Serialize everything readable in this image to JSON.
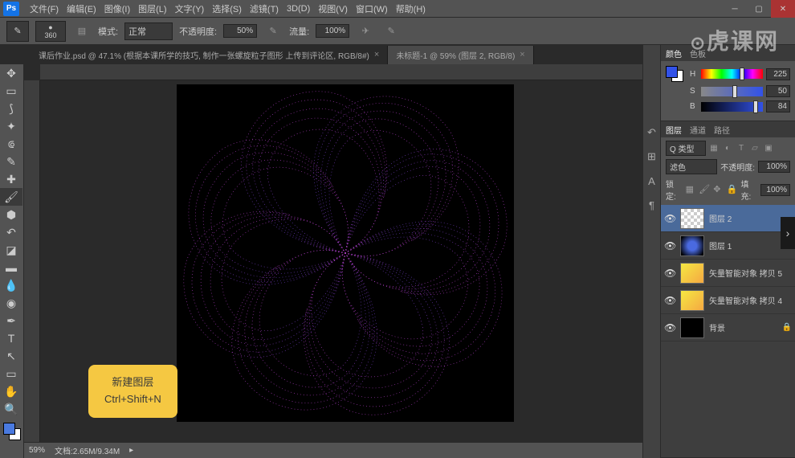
{
  "menubar": {
    "items": [
      "文件(F)",
      "编辑(E)",
      "图像(I)",
      "图层(L)",
      "文字(Y)",
      "选择(S)",
      "滤镜(T)",
      "3D(D)",
      "视图(V)",
      "窗口(W)",
      "帮助(H)"
    ]
  },
  "optbar": {
    "brush_size": "360",
    "mode_label": "模式:",
    "mode_value": "正常",
    "opacity_label": "不透明度:",
    "opacity_value": "50%",
    "flow_label": "流量:",
    "flow_value": "100%"
  },
  "tabs": [
    {
      "title": "课后作业.psd @ 47.1% (根据本课所学的技巧, 制作一张螺旋粒子图形 上传到评论区, RGB/8#)",
      "active": false
    },
    {
      "title": "未标题-1 @ 59% (图层 2, RGB/8)",
      "active": true
    }
  ],
  "annotation": {
    "line1": "新建图层",
    "line2": "Ctrl+Shift+N"
  },
  "watermark": "虎课网",
  "color_panel": {
    "tabs": [
      "颜色",
      "色板"
    ],
    "h": "225",
    "s": "50",
    "b": "84"
  },
  "layers_panel": {
    "tabs": [
      "图层",
      "通道",
      "路径"
    ],
    "kind": "Q 类型",
    "blend": "滤色",
    "opacity_label": "不透明度:",
    "opacity_value": "100%",
    "lock_label": "锁定:",
    "fill_label": "填充:",
    "fill_value": "100%",
    "layers": [
      {
        "name": "图层 2",
        "thumb": "checker",
        "selected": true,
        "locked": false
      },
      {
        "name": "图层 1",
        "thumb": "blue",
        "selected": false,
        "locked": false
      },
      {
        "name": "矢量智能对象 拷贝 5",
        "thumb": "yellow",
        "selected": false,
        "locked": false
      },
      {
        "name": "矢量智能对象 拷贝 4",
        "thumb": "yellow",
        "selected": false,
        "locked": false
      },
      {
        "name": "背景",
        "thumb": "black",
        "selected": false,
        "locked": true
      }
    ]
  },
  "statusbar": {
    "zoom": "59%",
    "doc_info": "文档:2.65M/9.34M"
  }
}
